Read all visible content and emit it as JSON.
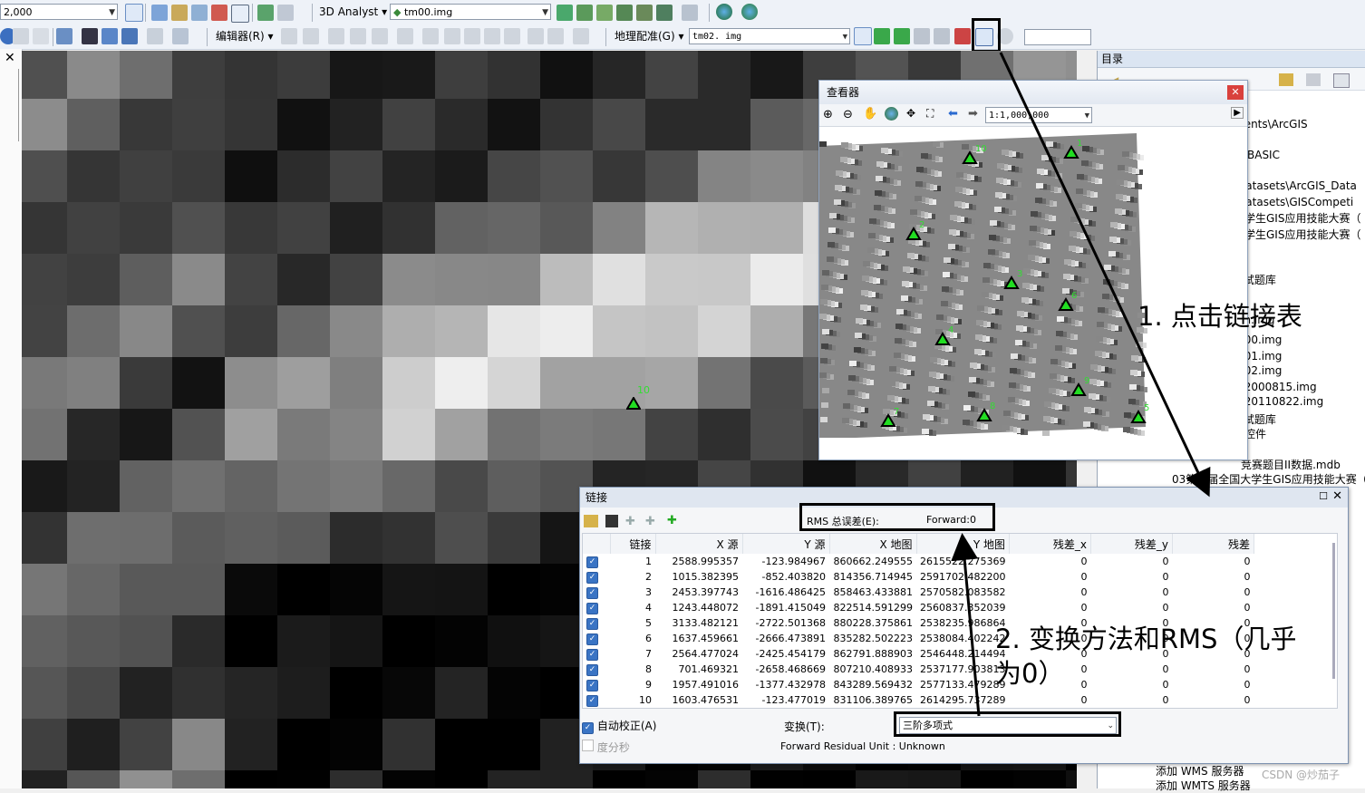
{
  "toolbar1": {
    "scale_value": "2,000",
    "analyst_label": "3D Analyst",
    "layer_value": "tm00.img"
  },
  "toolbar2": {
    "editor_label": "编辑器(R)",
    "georef_label": "地理配准(G)",
    "georef_layer": "tm02. img"
  },
  "toc": {
    "header": "目录",
    "lines": [
      "ments\\ArcGIS",
      "ts\\BASIC",
      "\\Datasets\\ArcGIS_Data",
      "\\Datasets\\GISCompeti",
      "大学生GIS应用技能大赛（",
      "大学生GIS应用技能大赛（",
      "II  试题库",
      "em.img",
      "m00.img",
      "m01.img",
      "m02.img",
      "m2000815.img",
      "m20110822.img",
      "II  试题库",
      "方控件",
      "竞赛题目II数据.mdb",
      "03第三届全国大学生GIS应用技能大赛（",
      "添加 WMS 服务器",
      "添加 WMTS 服务器"
    ]
  },
  "viewer": {
    "title": "查看器",
    "scale": "1:1,000,000",
    "gcps": [
      {
        "id": "1"
      },
      {
        "id": "2"
      },
      {
        "id": "3"
      },
      {
        "id": "4"
      },
      {
        "id": "5"
      },
      {
        "id": "6"
      },
      {
        "id": "7"
      },
      {
        "id": "8"
      },
      {
        "id": "9"
      },
      {
        "id": "10"
      }
    ]
  },
  "map": {
    "gcp_label": "10"
  },
  "links": {
    "title": "链接",
    "rms_label": "RMS 总误差(E):",
    "rms_value": "Forward:0",
    "columns": [
      "链接",
      "X 源",
      "Y 源",
      "X 地图",
      "Y 地图",
      "残差_x",
      "残差_y",
      "残差"
    ],
    "rows": [
      [
        "1",
        "2588.995357",
        "-123.984967",
        "860662.249555",
        "2615522.275369",
        "0",
        "0",
        "0"
      ],
      [
        "2",
        "1015.382395",
        "-852.403820",
        "814356.714945",
        "2591702.482200",
        "0",
        "0",
        "0"
      ],
      [
        "3",
        "2453.397743",
        "-1616.486425",
        "858463.433881",
        "2570582.083582",
        "0",
        "0",
        "0"
      ],
      [
        "4",
        "1243.448072",
        "-1891.415049",
        "822514.591299",
        "2560837.352039",
        "0",
        "0",
        "0"
      ],
      [
        "5",
        "3133.482121",
        "-2722.501368",
        "880228.375861",
        "2538235.986864",
        "0",
        "0",
        "0"
      ],
      [
        "6",
        "1637.459661",
        "-2666.473891",
        "835282.502223",
        "2538084.402242",
        "0",
        "0",
        "0"
      ],
      [
        "7",
        "2564.477024",
        "-2425.454179",
        "862791.888903",
        "2546448.214494",
        "0",
        "0",
        "0"
      ],
      [
        "8",
        "701.469321",
        "-2658.468669",
        "807210.408933",
        "2537177.903813",
        "0",
        "0",
        "0"
      ],
      [
        "9",
        "1957.491016",
        "-1377.432978",
        "843289.569432",
        "2577133.479289",
        "0",
        "0",
        "0"
      ],
      [
        "10",
        "1603.476531",
        "-123.477019",
        "831106.389765",
        "2614295.737289",
        "0",
        "0",
        "0"
      ]
    ],
    "auto_adjust": "自动校正(A)",
    "transform_label": "变换(T):",
    "transform_value": "三阶多项式",
    "dms": "度分秒",
    "residual_unit": "Forward Residual Unit : Unknown"
  },
  "annotations": {
    "step1": "1. 点击链接表",
    "step2_line1": "2. 变换方法和RMS（几乎",
    "step2_line2": "为0）"
  },
  "watermark": "CSDN @炒茄子",
  "colors": {
    "highlight": "#000000",
    "gcp": "#22dd22",
    "checkbox": "#3a74c4"
  }
}
